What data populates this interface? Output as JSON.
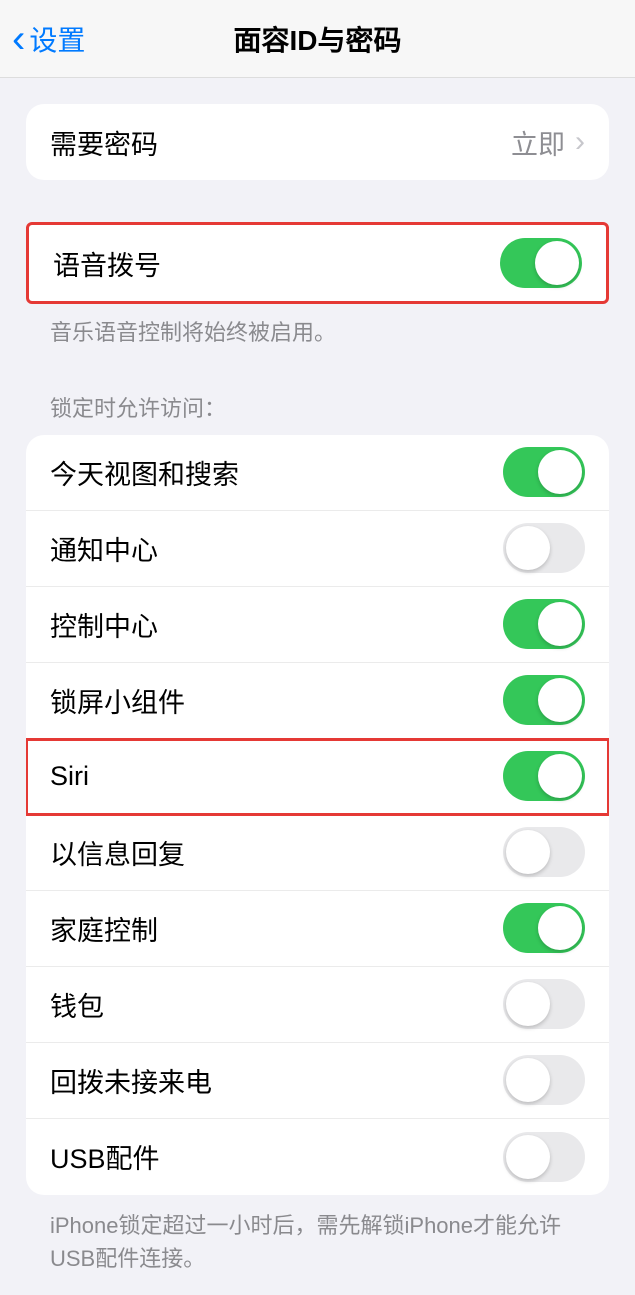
{
  "nav": {
    "back_label": "设置",
    "title": "面容ID与密码"
  },
  "passcode_section": {
    "require_passcode_label": "需要密码",
    "require_passcode_value": "立即"
  },
  "voice_dial": {
    "label": "语音拨号",
    "footer": "音乐语音控制将始终被启用。",
    "enabled": true
  },
  "lock_access": {
    "header": "锁定时允许访问：",
    "items": [
      {
        "label": "今天视图和搜索",
        "enabled": true,
        "highlighted": false
      },
      {
        "label": "通知中心",
        "enabled": false,
        "highlighted": false
      },
      {
        "label": "控制中心",
        "enabled": true,
        "highlighted": false
      },
      {
        "label": "锁屏小组件",
        "enabled": true,
        "highlighted": false
      },
      {
        "label": "Siri",
        "enabled": true,
        "highlighted": true
      },
      {
        "label": "以信息回复",
        "enabled": false,
        "highlighted": false
      },
      {
        "label": "家庭控制",
        "enabled": true,
        "highlighted": false
      },
      {
        "label": "钱包",
        "enabled": false,
        "highlighted": false
      },
      {
        "label": "回拨未接来电",
        "enabled": false,
        "highlighted": false
      },
      {
        "label": "USB配件",
        "enabled": false,
        "highlighted": false
      }
    ],
    "footer": "iPhone锁定超过一小时后，需先解锁iPhone才能允许USB配件连接。"
  }
}
